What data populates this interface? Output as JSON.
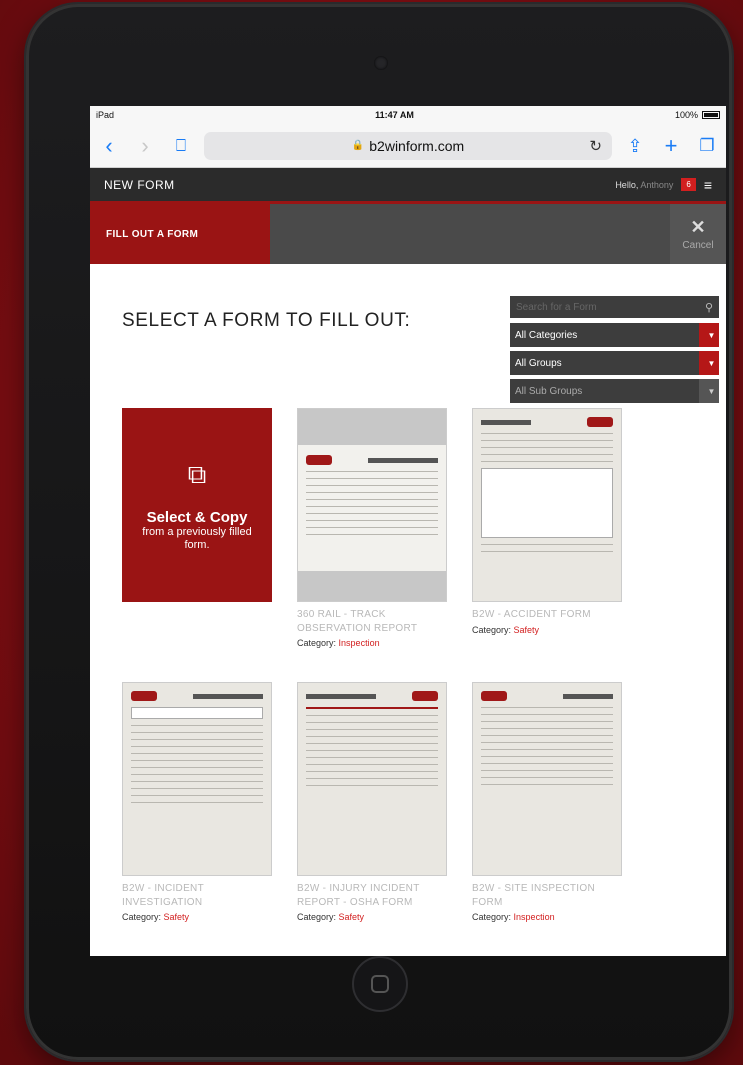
{
  "status_bar": {
    "device": "iPad",
    "time": "11:47 AM",
    "battery": "100%"
  },
  "browser": {
    "url": "b2winform.com"
  },
  "header": {
    "title": "NEW FORM",
    "greeting": "Hello,",
    "user_name": "Anthony",
    "notification_count": "6"
  },
  "subbar": {
    "tab_label": "FILL OUT A FORM",
    "cancel_label": "Cancel"
  },
  "main": {
    "heading": "SELECT A FORM TO FILL OUT:",
    "search_placeholder": "Search for a Form",
    "filters": [
      "All Categories",
      "All Groups",
      "All Sub Groups"
    ],
    "copy_card": {
      "title": "Select & Copy",
      "subtitle": "from a previously filled form."
    },
    "forms": [
      {
        "name": "360 RAIL - TRACK OBSERVATION REPORT",
        "category_label": "Category:",
        "category": "Inspection"
      },
      {
        "name": "B2W - ACCIDENT FORM",
        "category_label": "Category:",
        "category": "Safety"
      },
      {
        "name": "B2W - INCIDENT INVESTIGATION",
        "category_label": "Category:",
        "category": "Safety"
      },
      {
        "name": "B2W - INJURY INCIDENT REPORT - OSHA FORM",
        "category_label": "Category:",
        "category": "Safety"
      },
      {
        "name": "B2W - SITE INSPECTION FORM",
        "category_label": "Category:",
        "category": "Inspection"
      }
    ]
  },
  "colors": {
    "brand_red": "#9a1414",
    "accent_red": "#d21f1f",
    "header_dark": "#2b2b2b",
    "ios_blue": "#1a7cf5"
  }
}
